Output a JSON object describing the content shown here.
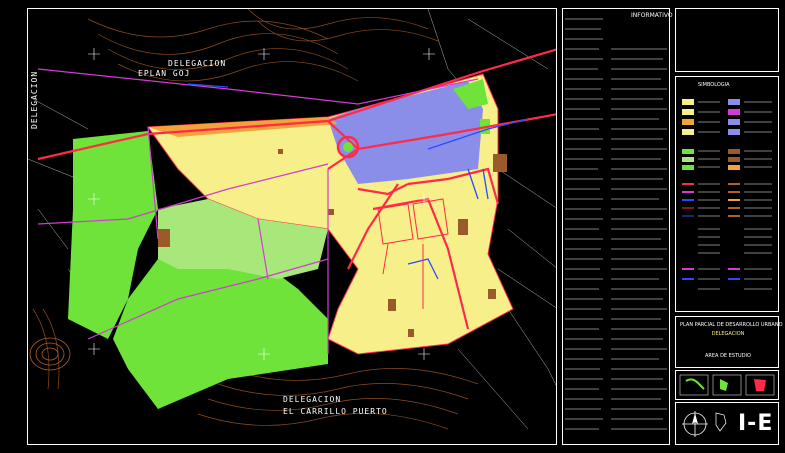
{
  "map": {
    "label_top_line1": "DELEGACION",
    "label_top_line2": "EPLAN GOJ",
    "label_bottom_line1": "DELEGACION",
    "label_bottom_line2": "EL CARRILLO PUERTO",
    "left_label": "DELEGACION"
  },
  "legend": {
    "header": "SIMBOLOGIA",
    "subheader": "INFORMATIVO",
    "plan_title": "PLAN PARCIAL DE DESARROLLO URBANO",
    "plan_subtitle": "DELEGACION",
    "plan_note": "AREA DE ESTUDIO",
    "sheet_code": "I-E"
  },
  "colors": {
    "urban_yellow": "#f7f08a",
    "green_bright": "#6fe33a",
    "green_light": "#a8e87a",
    "purple_zone": "#8a8ee8",
    "orange_zone": "#f2a33a",
    "road_red": "#ff2a4a",
    "road_magenta": "#d23cd2",
    "road_blue": "#2a4aff",
    "contour_brown": "#b0602a",
    "brown_lot": "#9a5a2a"
  }
}
